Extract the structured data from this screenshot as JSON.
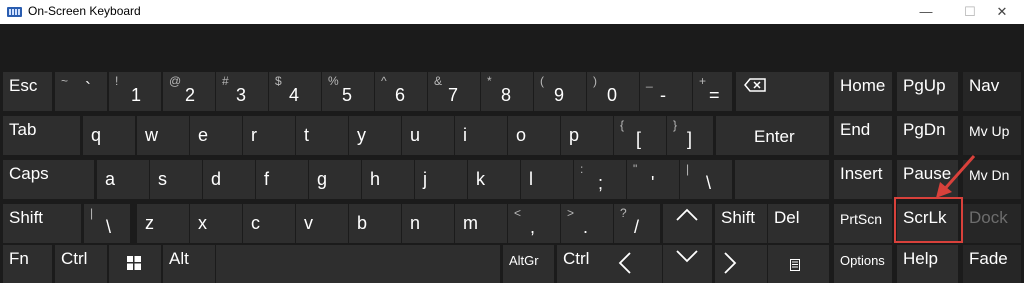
{
  "window": {
    "title": "On-Screen Keyboard",
    "minimize_icon": "—",
    "maximize_icon": "☐",
    "close_icon": "✕"
  },
  "colors": {
    "key": "#2e2e2e",
    "background": "#1b1b1b",
    "highlight": "#d9413b"
  },
  "row1": {
    "esc": "Esc",
    "tilde": {
      "shift": "~",
      "main": "`"
    },
    "k1": {
      "shift": "!",
      "main": "1"
    },
    "k2": {
      "shift": "@",
      "main": "2"
    },
    "k3": {
      "shift": "#",
      "main": "3"
    },
    "k4": {
      "shift": "$",
      "main": "4"
    },
    "k5": {
      "shift": "%",
      "main": "5"
    },
    "k6": {
      "shift": "^",
      "main": "6"
    },
    "k7": {
      "shift": "&",
      "main": "7"
    },
    "k8": {
      "shift": "*",
      "main": "8"
    },
    "k9": {
      "shift": "(",
      "main": "9"
    },
    "k0": {
      "shift": ")",
      "main": "0"
    },
    "minus": {
      "shift": "_",
      "main": "-"
    },
    "equals": {
      "shift": "+",
      "main": "="
    },
    "backspace_icon": "backspace-icon"
  },
  "row2": {
    "tab": "Tab",
    "q": "q",
    "w": "w",
    "e": "e",
    "r": "r",
    "t": "t",
    "y": "y",
    "u": "u",
    "i": "i",
    "o": "o",
    "p": "p",
    "lbracket": {
      "shift": "{",
      "main": "["
    },
    "rbracket": {
      "shift": "}",
      "main": "]"
    },
    "enter": "Enter"
  },
  "row3": {
    "caps": "Caps",
    "a": "a",
    "s": "s",
    "d": "d",
    "f": "f",
    "g": "g",
    "h": "h",
    "j": "j",
    "k": "k",
    "l": "l",
    "semicolon": {
      "shift": ":",
      "main": ";"
    },
    "quote": {
      "shift": "\"",
      "main": "'"
    },
    "backslash": {
      "shift": "|",
      "main": "\\"
    }
  },
  "row4": {
    "shift": "Shift",
    "pipe": {
      "shift": "|",
      "main": "\\"
    },
    "z": "z",
    "x": "x",
    "c": "c",
    "v": "v",
    "b": "b",
    "n": "n",
    "m": "m",
    "comma": {
      "shift": "<",
      "main": ","
    },
    "period": {
      "shift": ">",
      "main": "."
    },
    "slash": {
      "shift": "?",
      "main": "/"
    },
    "up_icon": "up-arrow-icon",
    "rshift": "Shift",
    "del": "Del"
  },
  "row5": {
    "fn": "Fn",
    "ctrl": "Ctrl",
    "win_icon": "windows-logo-icon",
    "alt": "Alt",
    "altgr": "AltGr",
    "rctrl": "Ctrl",
    "left_icon": "left-arrow-icon",
    "down_icon": "down-arrow-icon",
    "right_icon": "right-arrow-icon",
    "menu_icon": "context-menu-icon"
  },
  "nav": {
    "home": "Home",
    "pgup": "PgUp",
    "navkey": "Nav",
    "end": "End",
    "pgdn": "PgDn",
    "mvup": "Mv Up",
    "insert": "Insert",
    "pause": "Pause",
    "mvdn": "Mv Dn",
    "prtscn": "PrtScn",
    "scrlk": "ScrLk",
    "dock": "Dock",
    "options": "Options",
    "help": "Help",
    "fade": "Fade"
  }
}
